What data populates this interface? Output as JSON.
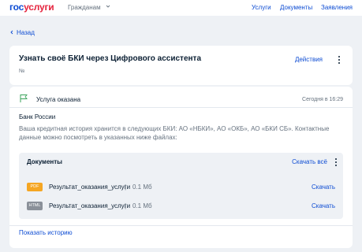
{
  "colors": {
    "brand_blue": "#0d4cd3",
    "brand_red": "#e5233d",
    "pdf_badge": "#f5a623",
    "html_badge": "#8a9099",
    "status_flag": "#3aa35a"
  },
  "header": {
    "logo_part1": "гос",
    "logo_part2": "услуги",
    "audience_selector": "Гражданам",
    "nav": [
      "Услуги",
      "Документы",
      "Заявления"
    ]
  },
  "back_link": "Назад",
  "service": {
    "title": "Узнать своё БКИ через Цифрового ассистента",
    "number_label": "№",
    "actions_label": "Действия"
  },
  "status_card": {
    "status": "Услуга оказана",
    "time": "Сегодня в 16:29",
    "organization": "Банк России",
    "message": "Ваша кредитная история хранится в следующих БКИ: АО «НБКИ», АО «ОКБ», АО «БКИ СБ». Контактные данные можно посмотреть в указанных ниже файлах:"
  },
  "documents": {
    "title": "Документы",
    "download_all": "Скачать всё",
    "files": [
      {
        "type": "PDF",
        "name": "Результат_оказания_услуги",
        "separator": "|",
        "size": "0.1 Мб",
        "action": "Скачать"
      },
      {
        "type": "HTML",
        "name": "Результат_оказания_услуги",
        "separator": "|",
        "size": "0.1 Мб",
        "action": "Скачать"
      }
    ]
  },
  "history_link": "Показать историю"
}
